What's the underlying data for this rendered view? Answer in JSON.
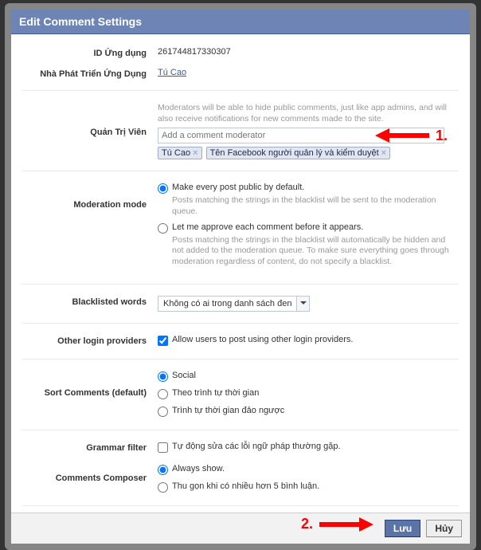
{
  "header": {
    "title": "Edit Comment Settings"
  },
  "app_id": {
    "label": "ID Ứng dụng",
    "value": "261744817330307"
  },
  "developer": {
    "label": "Nhà Phát Triển Ứng Dụng",
    "value": "Tú Cao"
  },
  "moderators": {
    "label": "Quản Trị Viên",
    "desc": "Moderators will be able to hide public comments, just like app admins, and will also receive notifications for new comments made to the site.",
    "placeholder": "Add a comment moderator",
    "tokens": [
      "Tú Cao",
      "Tên Facebook người quản lý và kiểm duyệt"
    ]
  },
  "moderation": {
    "label": "Moderation mode",
    "opt1": "Make every post public by default.",
    "opt1_desc": "Posts matching the strings in the blacklist will be sent to the moderation queue.",
    "opt2": "Let me approve each comment before it appears.",
    "opt2_desc": "Posts matching the strings in the blacklist will automatically be hidden and not added to the moderation queue. To make sure everything goes through moderation regardless of content, do not specify a blacklist."
  },
  "blacklist": {
    "label": "Blacklisted words",
    "value": "Không có ai trong danh sách đen"
  },
  "other_login": {
    "label": "Other login providers",
    "text": "Allow users to post using other login providers."
  },
  "sort": {
    "label": "Sort Comments (default)",
    "opt1": "Social",
    "opt2": "Theo trình tự thời gian",
    "opt3": "Trình tự thời gian đảo ngược"
  },
  "grammar": {
    "label": "Grammar filter",
    "text": "Tự động sửa các lỗi ngữ pháp thường gặp."
  },
  "composer": {
    "label": "Comments Composer",
    "opt1": "Always show.",
    "opt2": "Thu gọn khi có nhiều hơn 5 bình luận."
  },
  "footer": {
    "save": "Lưu",
    "cancel": "Hủy"
  },
  "annotations": {
    "one": "1.",
    "two": "2."
  }
}
